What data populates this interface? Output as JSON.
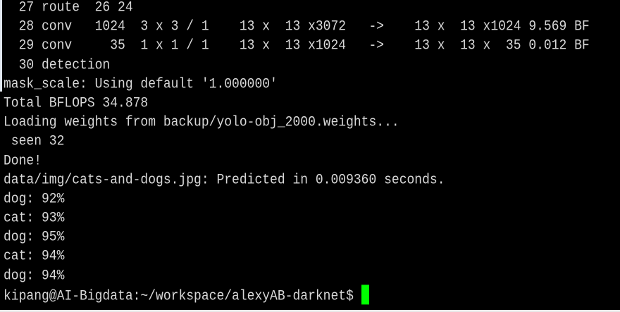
{
  "terminal": {
    "lines": [
      "  27 route  26 24",
      "  28 conv   1024  3 x 3 / 1    13 x  13 x3072   ->    13 x  13 x1024 9.569 BF",
      "  29 conv     35  1 x 1 / 1    13 x  13 x1024   ->    13 x  13 x  35 0.012 BF",
      "  30 detection",
      "mask_scale: Using default '1.000000'",
      "Total BFLOPS 34.878",
      "Loading weights from backup/yolo-obj_2000.weights...",
      " seen 32",
      "Done!",
      "data/img/cats-and-dogs.jpg: Predicted in 0.009360 seconds.",
      "dog: 92%",
      "cat: 93%",
      "dog: 95%",
      "cat: 94%",
      "dog: 94%"
    ],
    "prompt": "kipang@AI-Bigdata:~/workspace/alexyAB-darknet$ ",
    "cursor_color": "#00ff00",
    "text_color": "#d8d8d8",
    "background": "#000000"
  }
}
